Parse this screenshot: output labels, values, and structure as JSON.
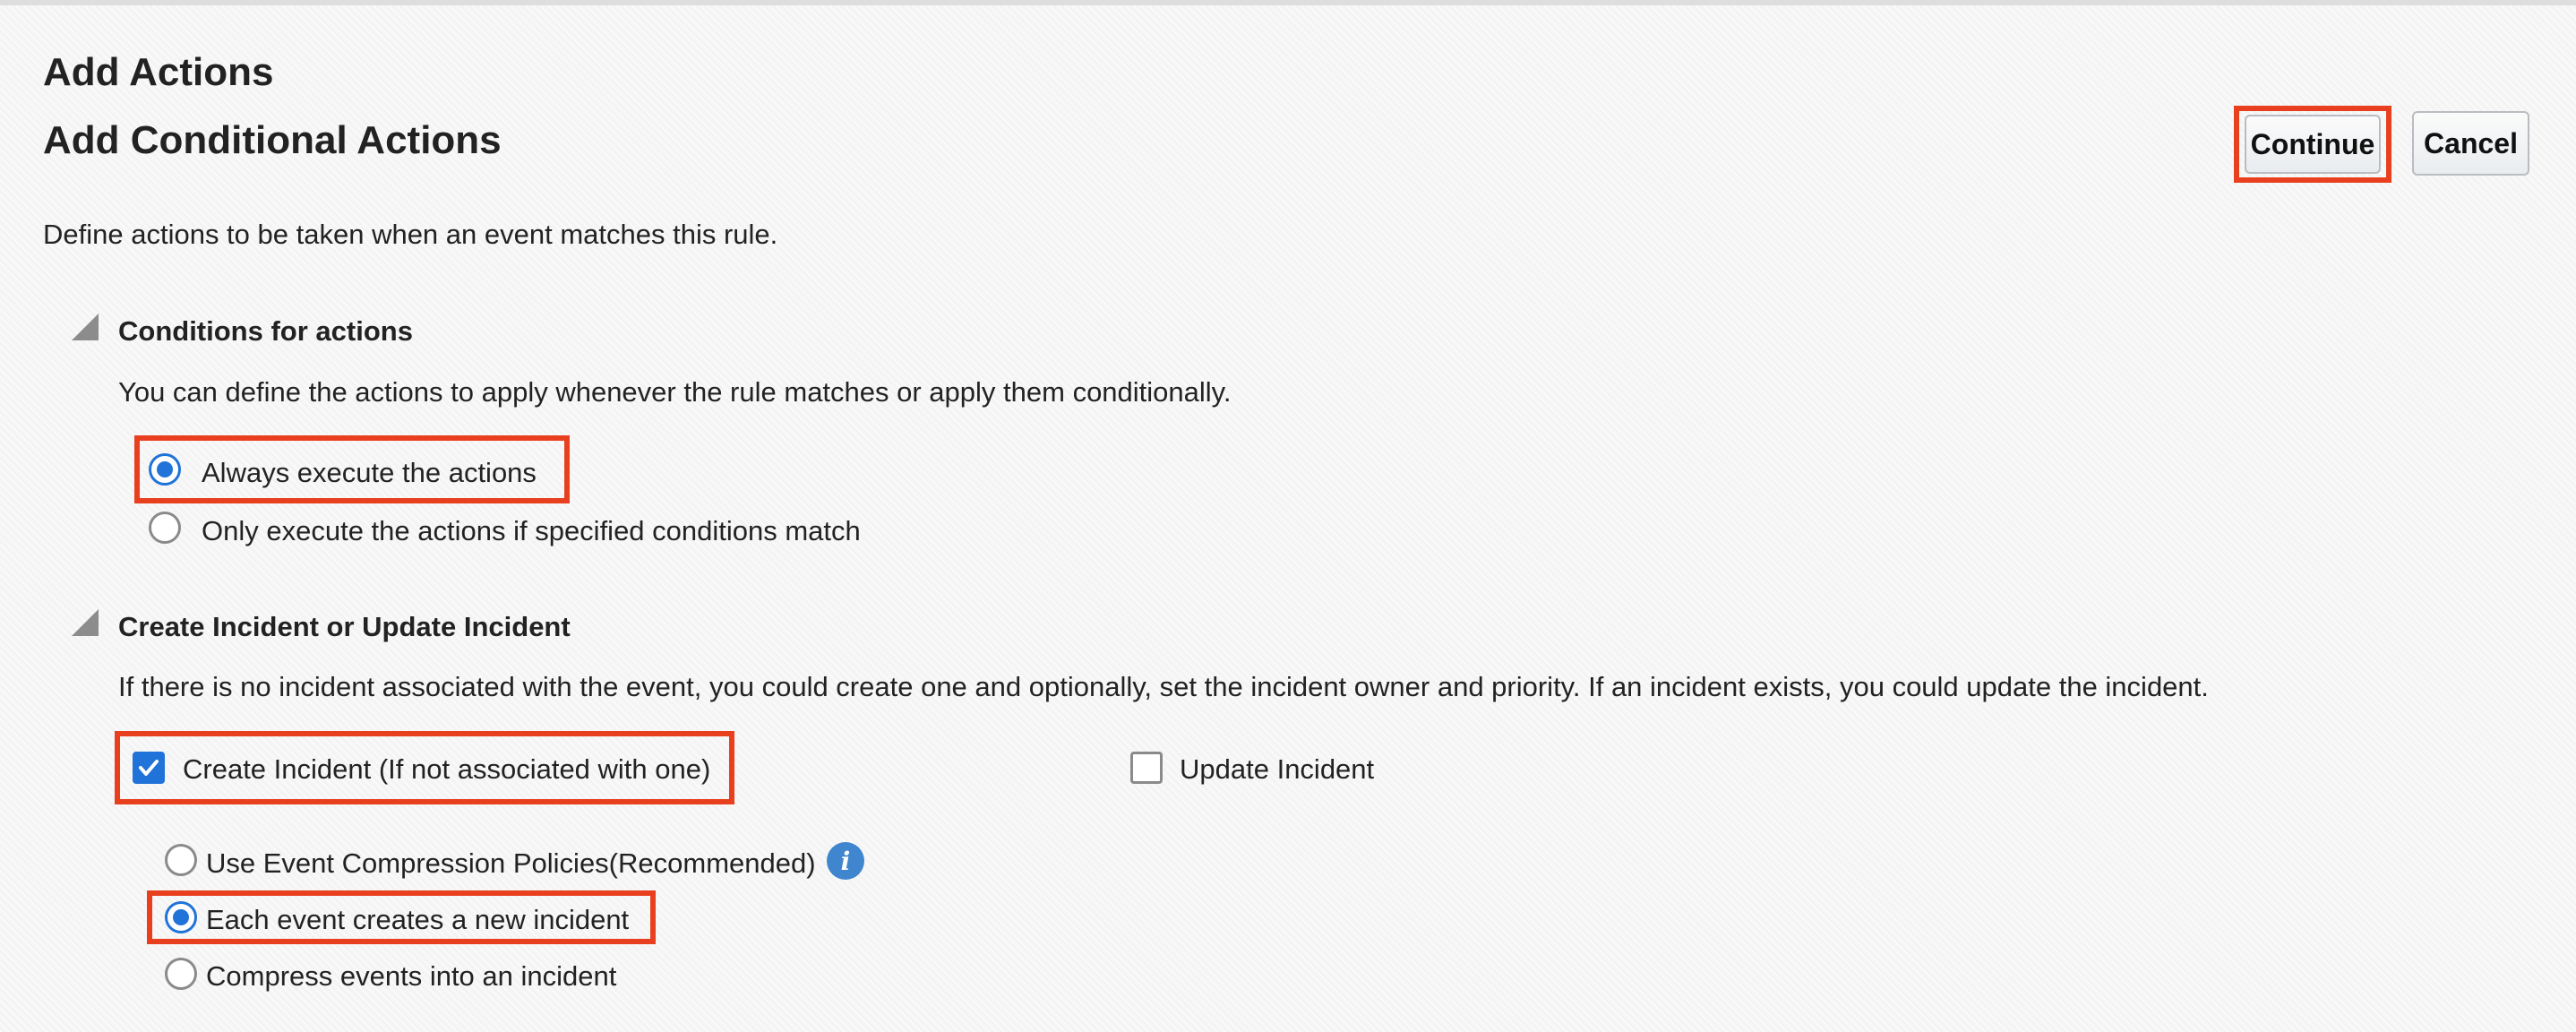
{
  "page": {
    "title": "Add Actions",
    "subtitle": "Add Conditional Actions",
    "description": "Define actions to be taken when an event matches this rule."
  },
  "buttons": {
    "continue_label": "Continue",
    "cancel_label": "Cancel"
  },
  "conditions_section": {
    "title": "Conditions for actions",
    "description": "You can define the actions to apply whenever the rule matches or apply them conditionally.",
    "options": [
      {
        "label": "Always execute the actions",
        "selected": true
      },
      {
        "label": "Only execute the actions if specified conditions match",
        "selected": false
      }
    ]
  },
  "incident_section": {
    "title": "Create Incident or Update Incident",
    "description": "If there is no incident associated with the event, you could create one and optionally, set the incident owner and priority. If an incident exists, you could update the incident.",
    "create_incident": {
      "label": "Create Incident (If not associated with one)",
      "checked": true
    },
    "update_incident": {
      "label": "Update Incident",
      "checked": false
    },
    "compression_options": [
      {
        "label": "Use Event Compression Policies(Recommended)",
        "selected": false
      },
      {
        "label": "Each event creates a new incident",
        "selected": true
      },
      {
        "label": "Compress events into an incident",
        "selected": false
      }
    ],
    "info_icon": "info-icon"
  },
  "colors": {
    "highlight": "#e8401f",
    "accent": "#1f73d9"
  }
}
